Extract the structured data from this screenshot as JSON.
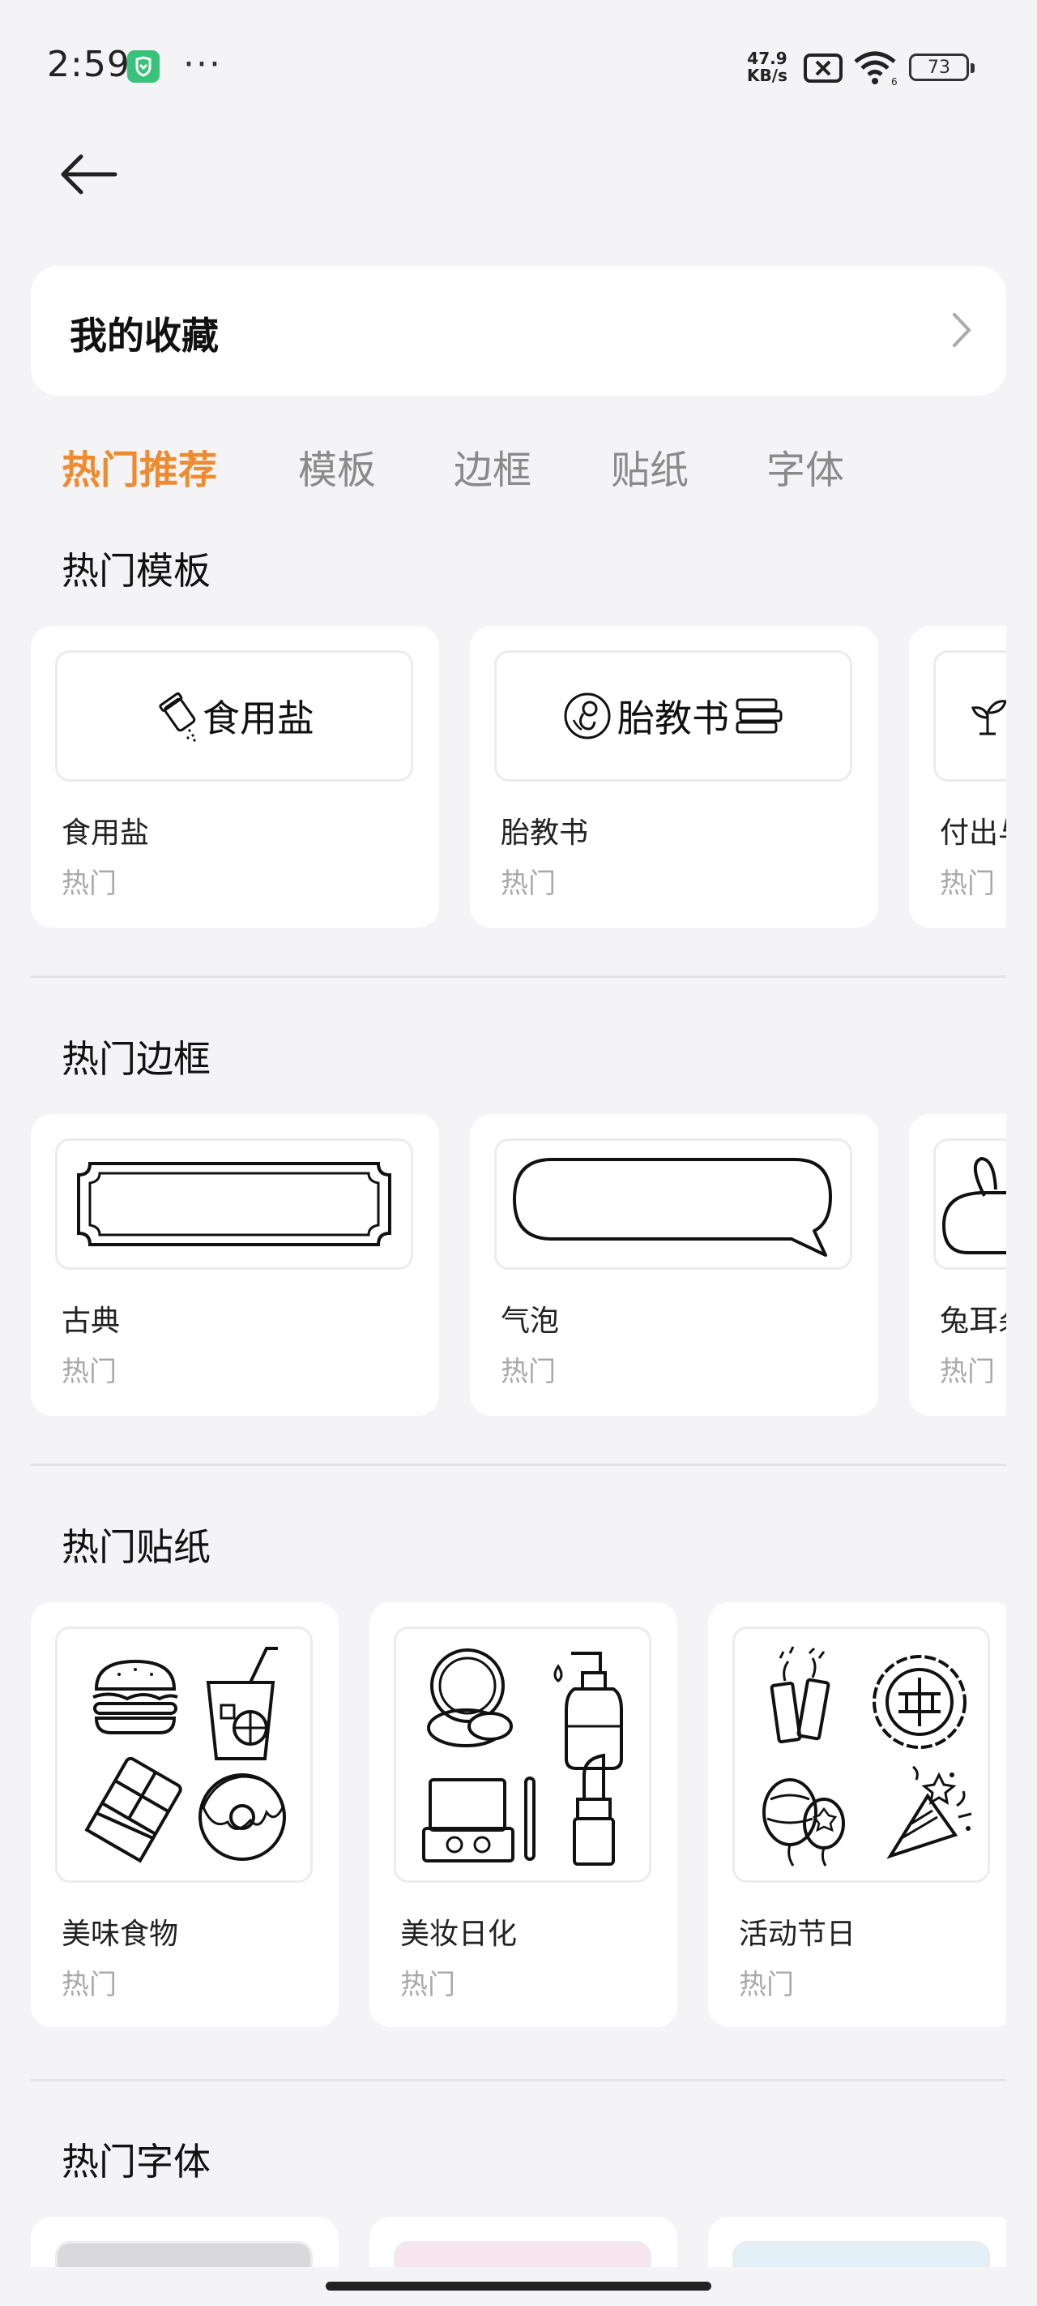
{
  "status": {
    "time": "2:59",
    "more": "···",
    "net_speed_value": "47.9",
    "net_speed_unit": "KB/s",
    "battery": "73",
    "wifi_label": "6"
  },
  "favorites": {
    "title": "我的收藏"
  },
  "tabs": [
    {
      "label": "热门推荐",
      "active": true
    },
    {
      "label": "模板"
    },
    {
      "label": "边框"
    },
    {
      "label": "贴纸"
    },
    {
      "label": "字体"
    }
  ],
  "sections": {
    "templates": {
      "title": "热门模板",
      "items": [
        {
          "name": "食用盐",
          "tag": "热门",
          "preview_text": "食用盐",
          "icon": "salt-shaker-icon"
        },
        {
          "name": "胎教书",
          "tag": "热门",
          "preview_text": "胎教书",
          "icon": "fetus-icon"
        },
        {
          "name": "付出与",
          "tag": "热门",
          "icon": "sprout-icon"
        }
      ]
    },
    "borders": {
      "title": "热门边框",
      "items": [
        {
          "name": "古典",
          "tag": "热门",
          "icon": "classic-frame-icon"
        },
        {
          "name": "气泡",
          "tag": "热门",
          "icon": "speech-bubble-icon"
        },
        {
          "name": "兔耳朵",
          "tag": "热门",
          "icon": "bunny-ear-frame-icon"
        }
      ]
    },
    "stickers": {
      "title": "热门贴纸",
      "items": [
        {
          "name": "美味食物",
          "tag": "热门",
          "icon": "food-sticker-icon"
        },
        {
          "name": "美妆日化",
          "tag": "热门",
          "icon": "cosmetics-sticker-icon"
        },
        {
          "name": "活动节日",
          "tag": "热门",
          "icon": "festival-sticker-icon"
        }
      ]
    },
    "fonts": {
      "title": "热门字体",
      "items": [
        {
          "icon": "font-preview-grey"
        },
        {
          "icon": "font-preview-pink"
        },
        {
          "icon": "font-preview-blue"
        }
      ]
    }
  },
  "colors": {
    "accent": "#ef8a2e",
    "background": "#f4f4f6",
    "card": "#ffffff",
    "tag": "#a9a9a9",
    "badge": "#38c27a"
  }
}
